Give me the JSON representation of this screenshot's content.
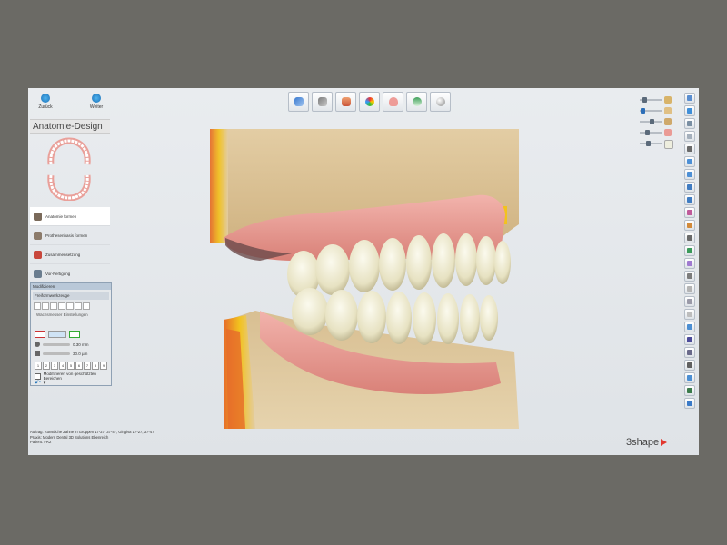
{
  "nav": {
    "back_label": "Zurück",
    "next_label": "Weiter"
  },
  "panel": {
    "title": "Anatomie-Design",
    "steps": [
      {
        "label": "Anatomie formen",
        "color": "#7a6a5a"
      },
      {
        "label": "Prothesenbasis formen",
        "color": "#8c7b6b"
      },
      {
        "label": "Zusammensetzung",
        "color": "#c8473c"
      },
      {
        "label": "Vor-Fertigung",
        "color": "#6a7d8f"
      }
    ]
  },
  "modify": {
    "header": "Modifizieren",
    "group1": "Freiformwerkzeuge",
    "group2": "Wachsmesser Einstellungen",
    "value1": "0.30 mm",
    "value2": "30.0 µm",
    "numbers": [
      "1",
      "2",
      "3",
      "4",
      "5",
      "6",
      "7",
      "8",
      "9"
    ],
    "checkbox_label": "Modifizieren von geschützten Bereichen"
  },
  "toolbar_icons": [
    "pen-tool-icon",
    "sculpt-tool-icon",
    "anatomy-icon",
    "color-palette-icon",
    "gingiva-icon",
    "teeth-view-icon",
    "sphere-icon"
  ],
  "status": {
    "line1": "Auftrag:   Künstliche Zähne in Gruppen 17-27, 37-47, Gingiva 17-27, 37-47",
    "line2": "Praxis:    Modern Dental 3D Solutions Ebenreich",
    "line3": "Patient:   FR2"
  },
  "logo": "3shape",
  "colors": {
    "accent": "#1b6fb5",
    "logo_red": "#e2382f",
    "model_tan": "#dcc396",
    "gingiva_pink": "#e9a09a",
    "teeth_ivory": "#eeebd0"
  }
}
